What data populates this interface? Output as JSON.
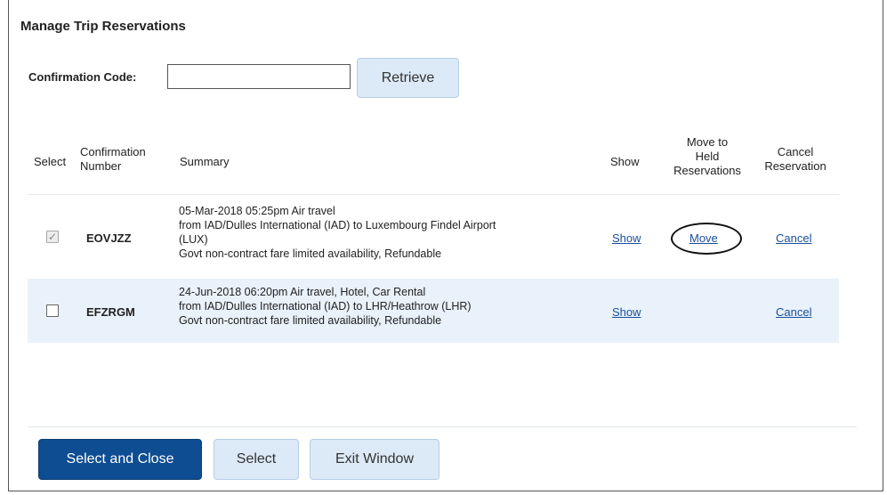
{
  "title": "Manage Trip Reservations",
  "form": {
    "code_label": "Confirmation Code:",
    "code_value": "",
    "retrieve_label": "Retrieve"
  },
  "table": {
    "headers": {
      "select": "Select",
      "conf_line1": "Confirmation",
      "conf_line2": "Number",
      "summary": "Summary",
      "show": "Show",
      "move_line1": "Move to",
      "move_line2": "Held",
      "move_line3": "Reservations",
      "cancel_line1": "Cancel",
      "cancel_line2": "Reservation"
    },
    "rows": [
      {
        "checked": true,
        "confirmation": "EOVJZZ",
        "summary": [
          "05-Mar-2018 05:25pm Air travel",
          "from IAD/Dulles International (IAD) to Luxembourg Findel Airport",
          "(LUX)",
          "Govt non-contract fare limited availability, Refundable"
        ],
        "show": "Show",
        "move": "Move",
        "cancel": "Cancel"
      },
      {
        "checked": false,
        "confirmation": "EFZRGM",
        "summary": [
          "24-Jun-2018 06:20pm Air travel, Hotel, Car Rental",
          "from IAD/Dulles International (IAD) to LHR/Heathrow (LHR)",
          "Govt non-contract fare limited availability, Refundable"
        ],
        "show": "Show",
        "cancel": "Cancel"
      }
    ]
  },
  "footer": {
    "select_close": "Select and Close",
    "select": "Select",
    "exit": "Exit Window"
  },
  "colors": {
    "primary": "#0e4d91",
    "light_button": "#dce9f7",
    "row_highlight": "#e9f1fa",
    "link": "#1a4f9c"
  }
}
